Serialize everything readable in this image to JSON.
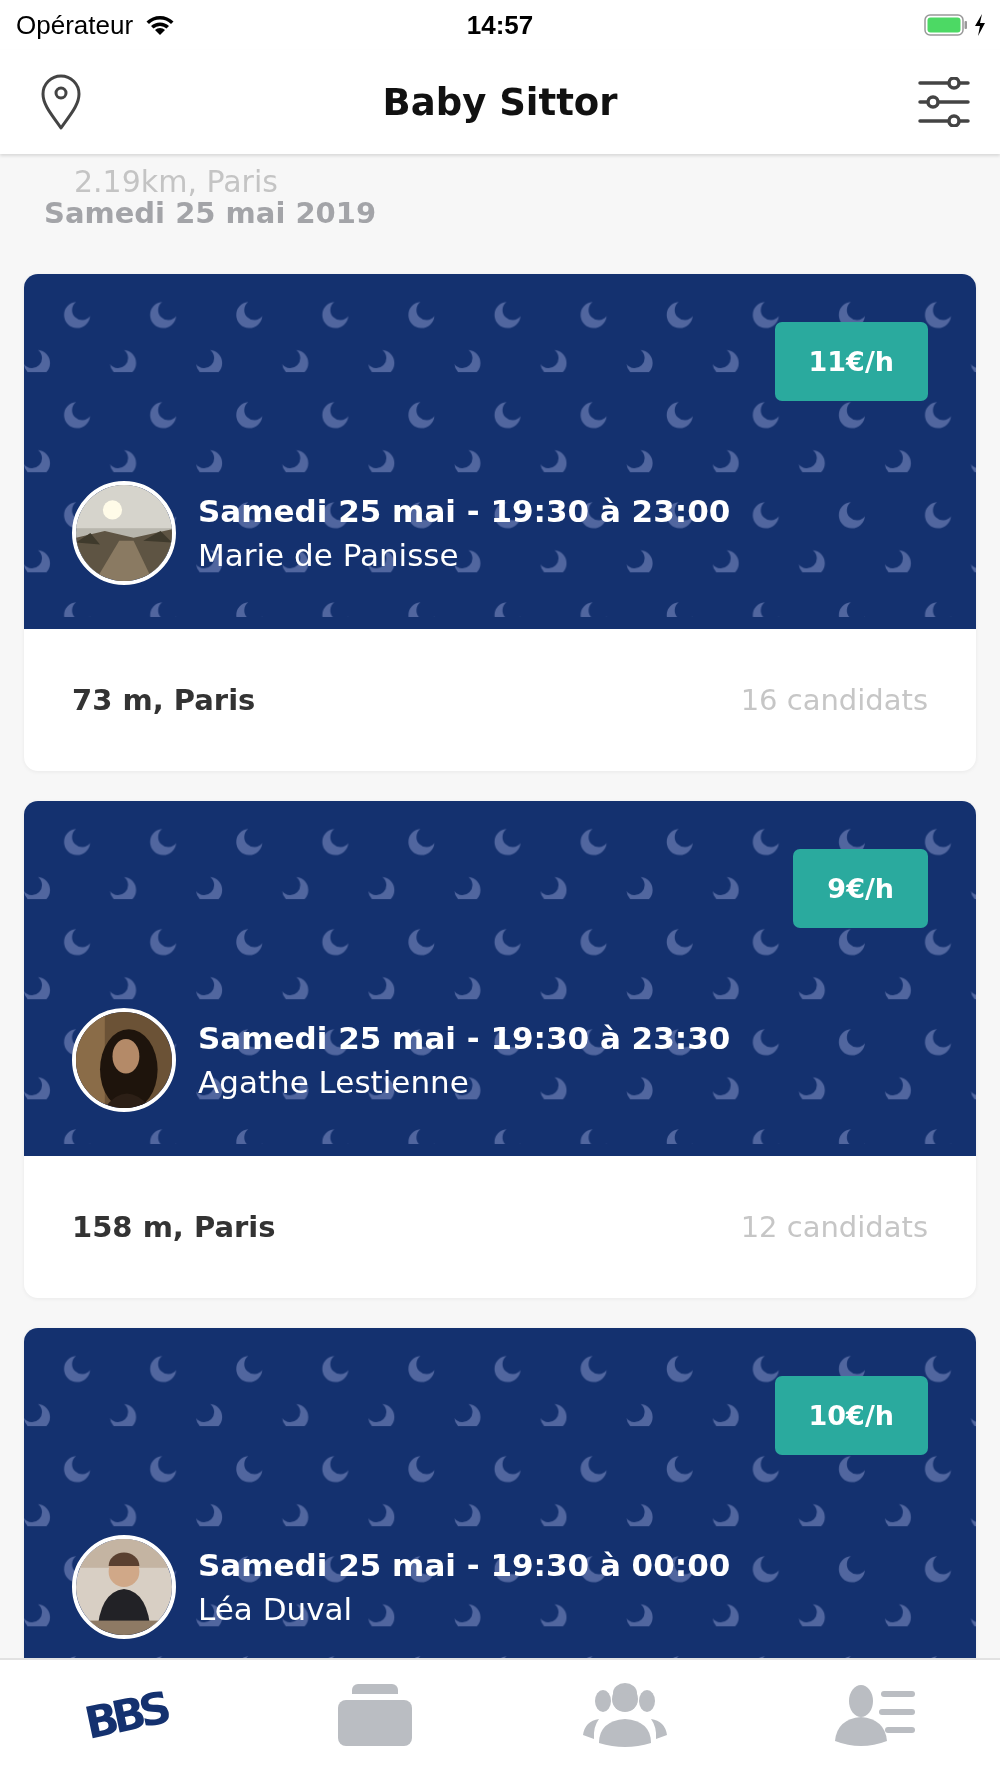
{
  "status_bar": {
    "carrier": "Opérateur",
    "time": "14:57",
    "charging": true
  },
  "header": {
    "title": "Baby Sittor"
  },
  "ghost_text": "2.19km, Paris",
  "date_label": "Samedi 25 mai 2019",
  "cards": [
    {
      "price": "11€/h",
      "title": "Samedi 25 mai - 19:30 à 23:00",
      "name": "Marie de Panisse",
      "distance": "73 m, Paris",
      "candidates": "16 candidats"
    },
    {
      "price": "9€/h",
      "title": "Samedi 25 mai - 19:30 à 23:30",
      "name": "Agathe Lestienne",
      "distance": "158 m, Paris",
      "candidates": "12 candidats"
    },
    {
      "price": "10€/h",
      "title": "Samedi 25 mai - 19:30 à 00:00",
      "name": "Léa Duval"
    }
  ],
  "tab_bar": [
    {
      "kind": "logo",
      "label": "BBS",
      "selected": true
    },
    {
      "kind": "cards",
      "selected": false
    },
    {
      "kind": "group",
      "selected": false
    },
    {
      "kind": "contacts",
      "selected": false
    }
  ]
}
